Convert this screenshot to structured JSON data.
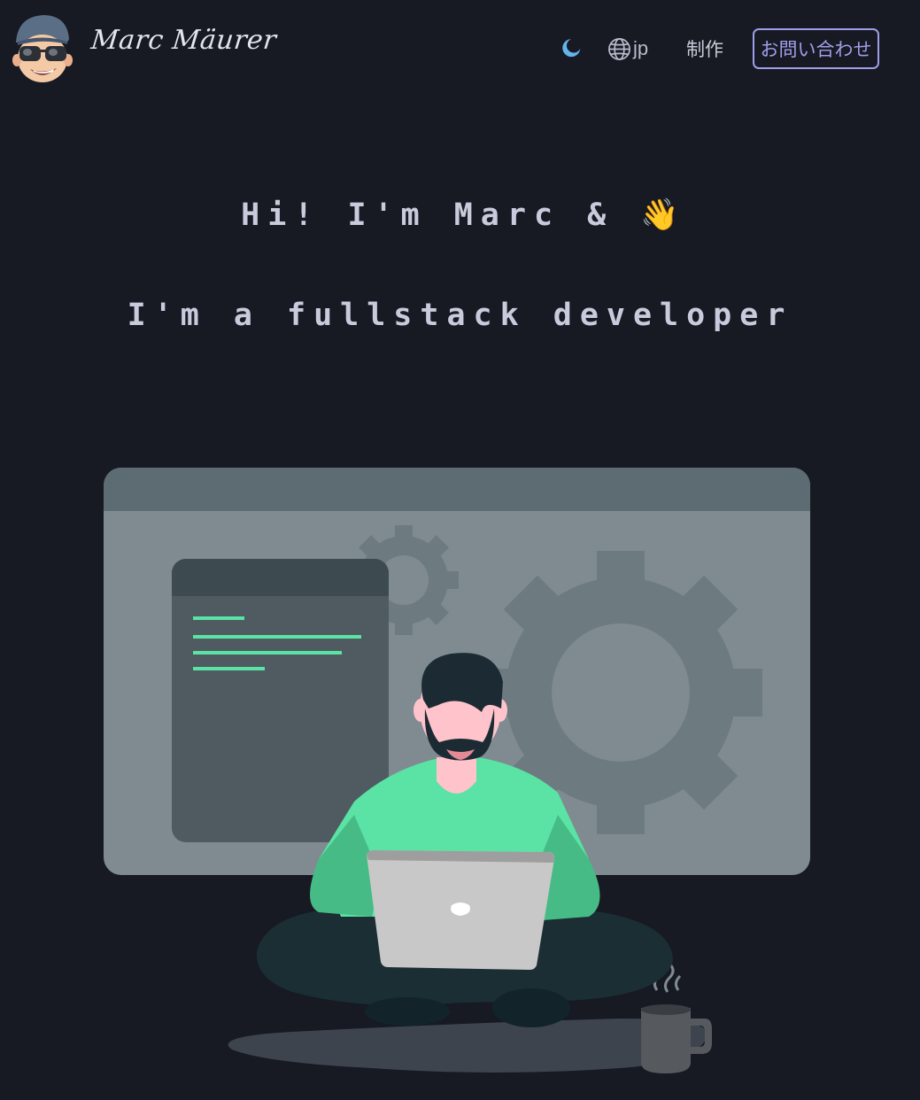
{
  "header": {
    "brand": "Marc Mäurer",
    "avatar_icon": "memoji-avatar-icon",
    "theme_toggle_icon": "moon-icon",
    "language": {
      "icon": "globe-icon",
      "label": "jp"
    },
    "works_label": "制作",
    "contact_label": "お問い合わせ"
  },
  "hero": {
    "line1": "Hi! I'm Marc & ",
    "wave_emoji": "👋",
    "line2": "I'm a fullstack developer"
  },
  "illustration": {
    "name": "developer-working-on-laptop",
    "colors": {
      "accent_green": "#5ae3a4",
      "dark_bg": "#171923"
    }
  }
}
